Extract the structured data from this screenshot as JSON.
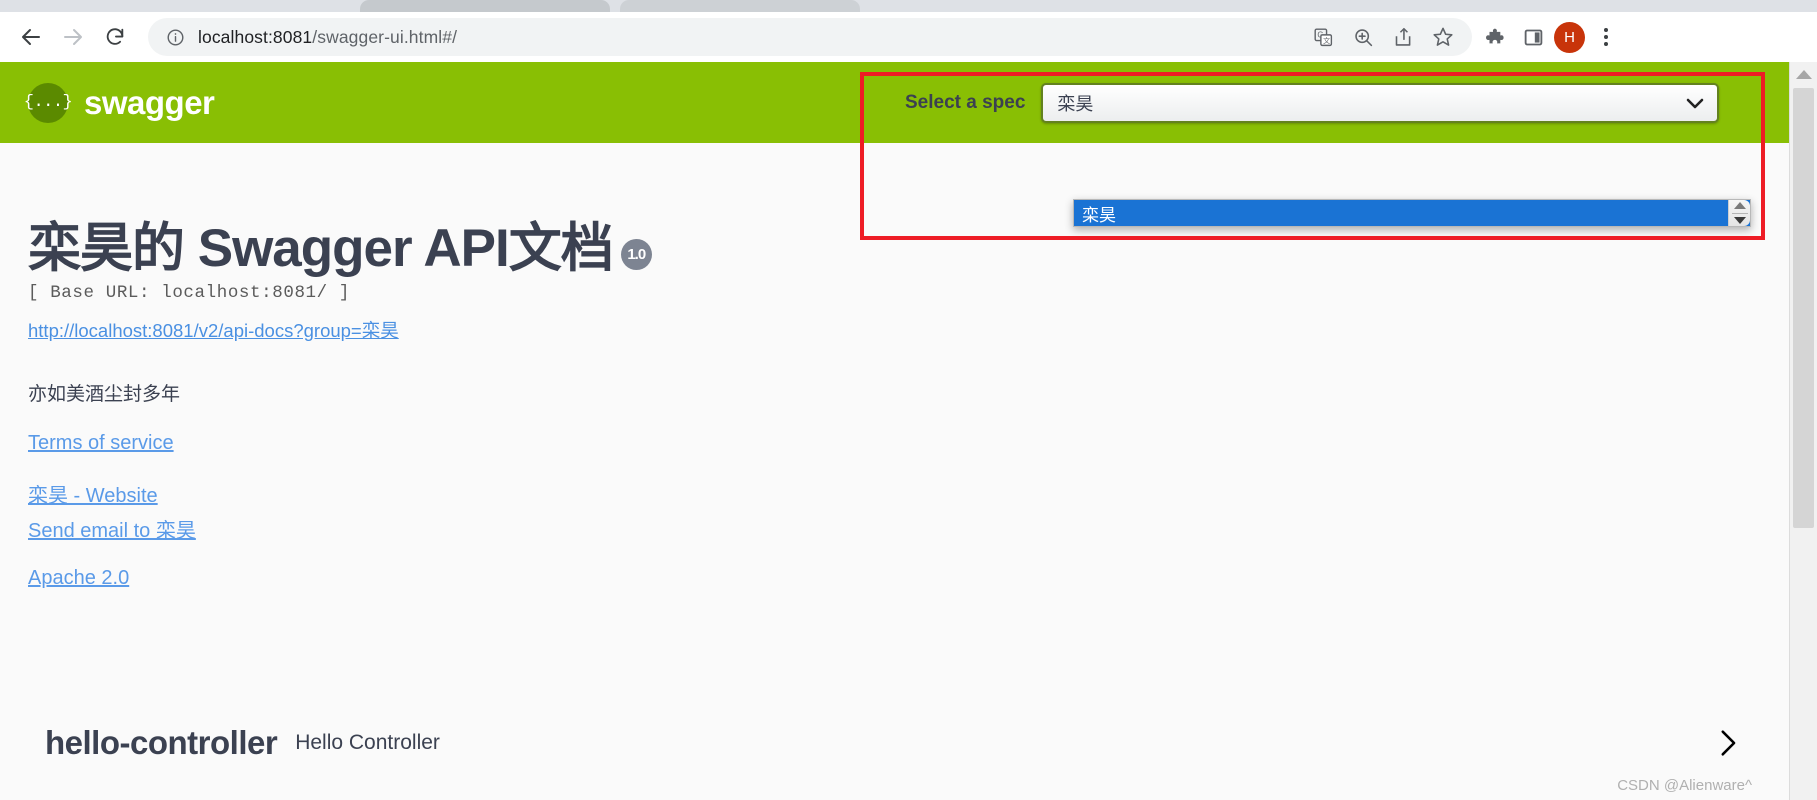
{
  "browser": {
    "back_icon": "arrow-left-icon",
    "forward_icon": "arrow-right-icon",
    "reload_icon": "reload-icon",
    "site_info_icon": "info-circle-icon",
    "url": "localhost:8081/swagger-ui.html#/",
    "url_host": "localhost:8081",
    "url_path": "/swagger-ui.html#/",
    "actions": [
      {
        "name": "translate-icon",
        "label": "Translate this page"
      },
      {
        "name": "zoom-icon",
        "label": "Zoom"
      },
      {
        "name": "share-icon",
        "label": "Share this page"
      },
      {
        "name": "bookmark-star-icon",
        "label": "Bookmark this tab"
      }
    ],
    "extensions_icon": "puzzle-piece-icon",
    "side_panel_icon": "side-panel-icon",
    "profile_initial": "H",
    "menu_icon": "three-dot-menu-icon"
  },
  "topbar": {
    "logo_glyph": "{...}",
    "logo_text": "swagger",
    "spec_label": "Select a spec",
    "spec_selected": "栾昊",
    "spec_chevron_icon": "chevron-down-icon",
    "spec_options": [
      "栾昊"
    ],
    "green": "#89bf04"
  },
  "dropdown": {
    "options": [
      "栾昊"
    ],
    "highlight_color": "#1a73d4",
    "scroll_up_icon": "scroll-up-arrow-icon",
    "scroll_down_icon": "scroll-down-arrow-icon"
  },
  "annotation": {
    "color": "#ee1c25"
  },
  "info": {
    "title": "栾昊的 Swagger API文档",
    "version": "1.0",
    "base_url": "[ Base URL: localhost:8081/ ]",
    "api_docs_url": "http://localhost:8081/v2/api-docs?group=栾昊",
    "description": "亦如美酒尘封多年",
    "terms_of_service": "Terms of service",
    "contact_website": "栾昊 - Website",
    "contact_email": "Send email to 栾昊",
    "license": "Apache 2.0"
  },
  "tags": [
    {
      "name": "hello-controller",
      "description": "Hello Controller",
      "expand_icon": "chevron-right-icon"
    }
  ],
  "watermark": "CSDN @Alienware^"
}
